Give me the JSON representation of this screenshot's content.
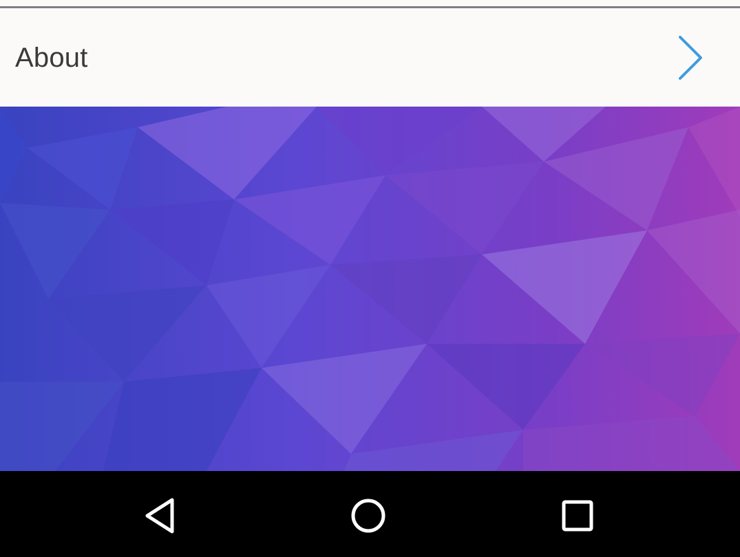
{
  "settings_list": {
    "about": {
      "label": "About",
      "chevron_icon": "chevron-right-icon",
      "chevron_color": "#3d9be0"
    }
  },
  "colors": {
    "row_background": "#fcfaf9",
    "divider": "#7d7f84",
    "label_text": "#3a3a3a",
    "nav_background": "#000000",
    "nav_icon": "#ffffff"
  },
  "navigation_bar": {
    "buttons": [
      {
        "name": "back",
        "icon": "back-triangle-icon"
      },
      {
        "name": "home",
        "icon": "home-circle-icon"
      },
      {
        "name": "recents",
        "icon": "recents-square-icon"
      }
    ]
  }
}
